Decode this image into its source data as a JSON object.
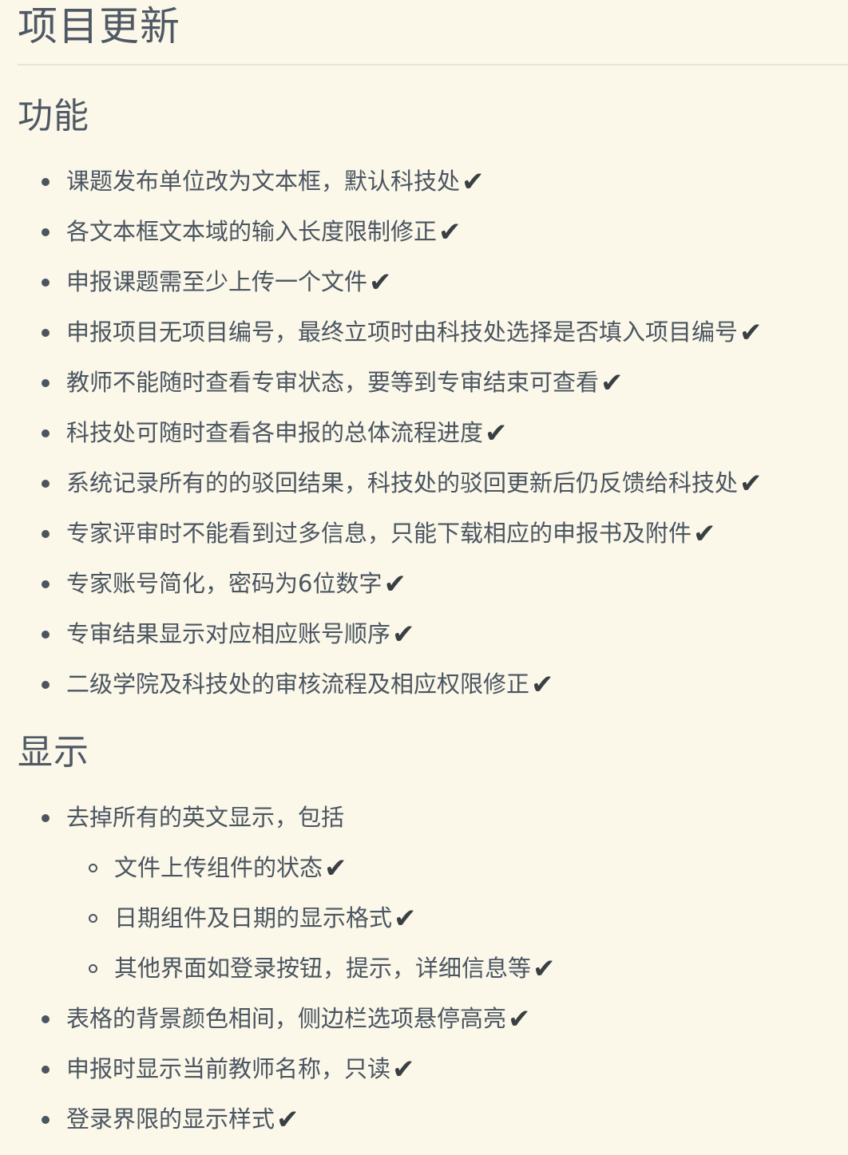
{
  "title": "项目更新",
  "check_mark": "✔",
  "sections": [
    {
      "heading": "功能",
      "items": [
        {
          "text": "课题发布单位改为文本框，默认科技处",
          "done": true
        },
        {
          "text": "各文本框文本域的输入长度限制修正",
          "done": true
        },
        {
          "text": "申报课题需至少上传一个文件",
          "done": true
        },
        {
          "text": "申报项目无项目编号，最终立项时由科技处选择是否填入项目编号",
          "done": true
        },
        {
          "text": "教师不能随时查看专审状态，要等到专审结束可查看",
          "done": true
        },
        {
          "text": "科技处可随时查看各申报的总体流程进度",
          "done": true
        },
        {
          "text": "系统记录所有的的驳回结果，科技处的驳回更新后仍反馈给科技处",
          "done": true
        },
        {
          "text": "专家评审时不能看到过多信息，只能下载相应的申报书及附件",
          "done": true
        },
        {
          "text": "专家账号简化，密码为6位数字",
          "done": true
        },
        {
          "text": "专审结果显示对应相应账号顺序",
          "done": true
        },
        {
          "text": "二级学院及科技处的审核流程及相应权限修正",
          "done": true
        }
      ]
    },
    {
      "heading": "显示",
      "items": [
        {
          "text": "去掉所有的英文显示，包括",
          "done": false,
          "subitems": [
            {
              "text": "文件上传组件的状态",
              "done": true
            },
            {
              "text": "日期组件及日期的显示格式",
              "done": true
            },
            {
              "text": "其他界面如登录按钮，提示，详细信息等",
              "done": true
            }
          ]
        },
        {
          "text": "表格的背景颜色相间，侧边栏选项悬停高亮",
          "done": true
        },
        {
          "text": "申报时显示当前教师名称，只读",
          "done": true
        },
        {
          "text": "登录界限的显示样式",
          "done": true
        }
      ]
    }
  ]
}
